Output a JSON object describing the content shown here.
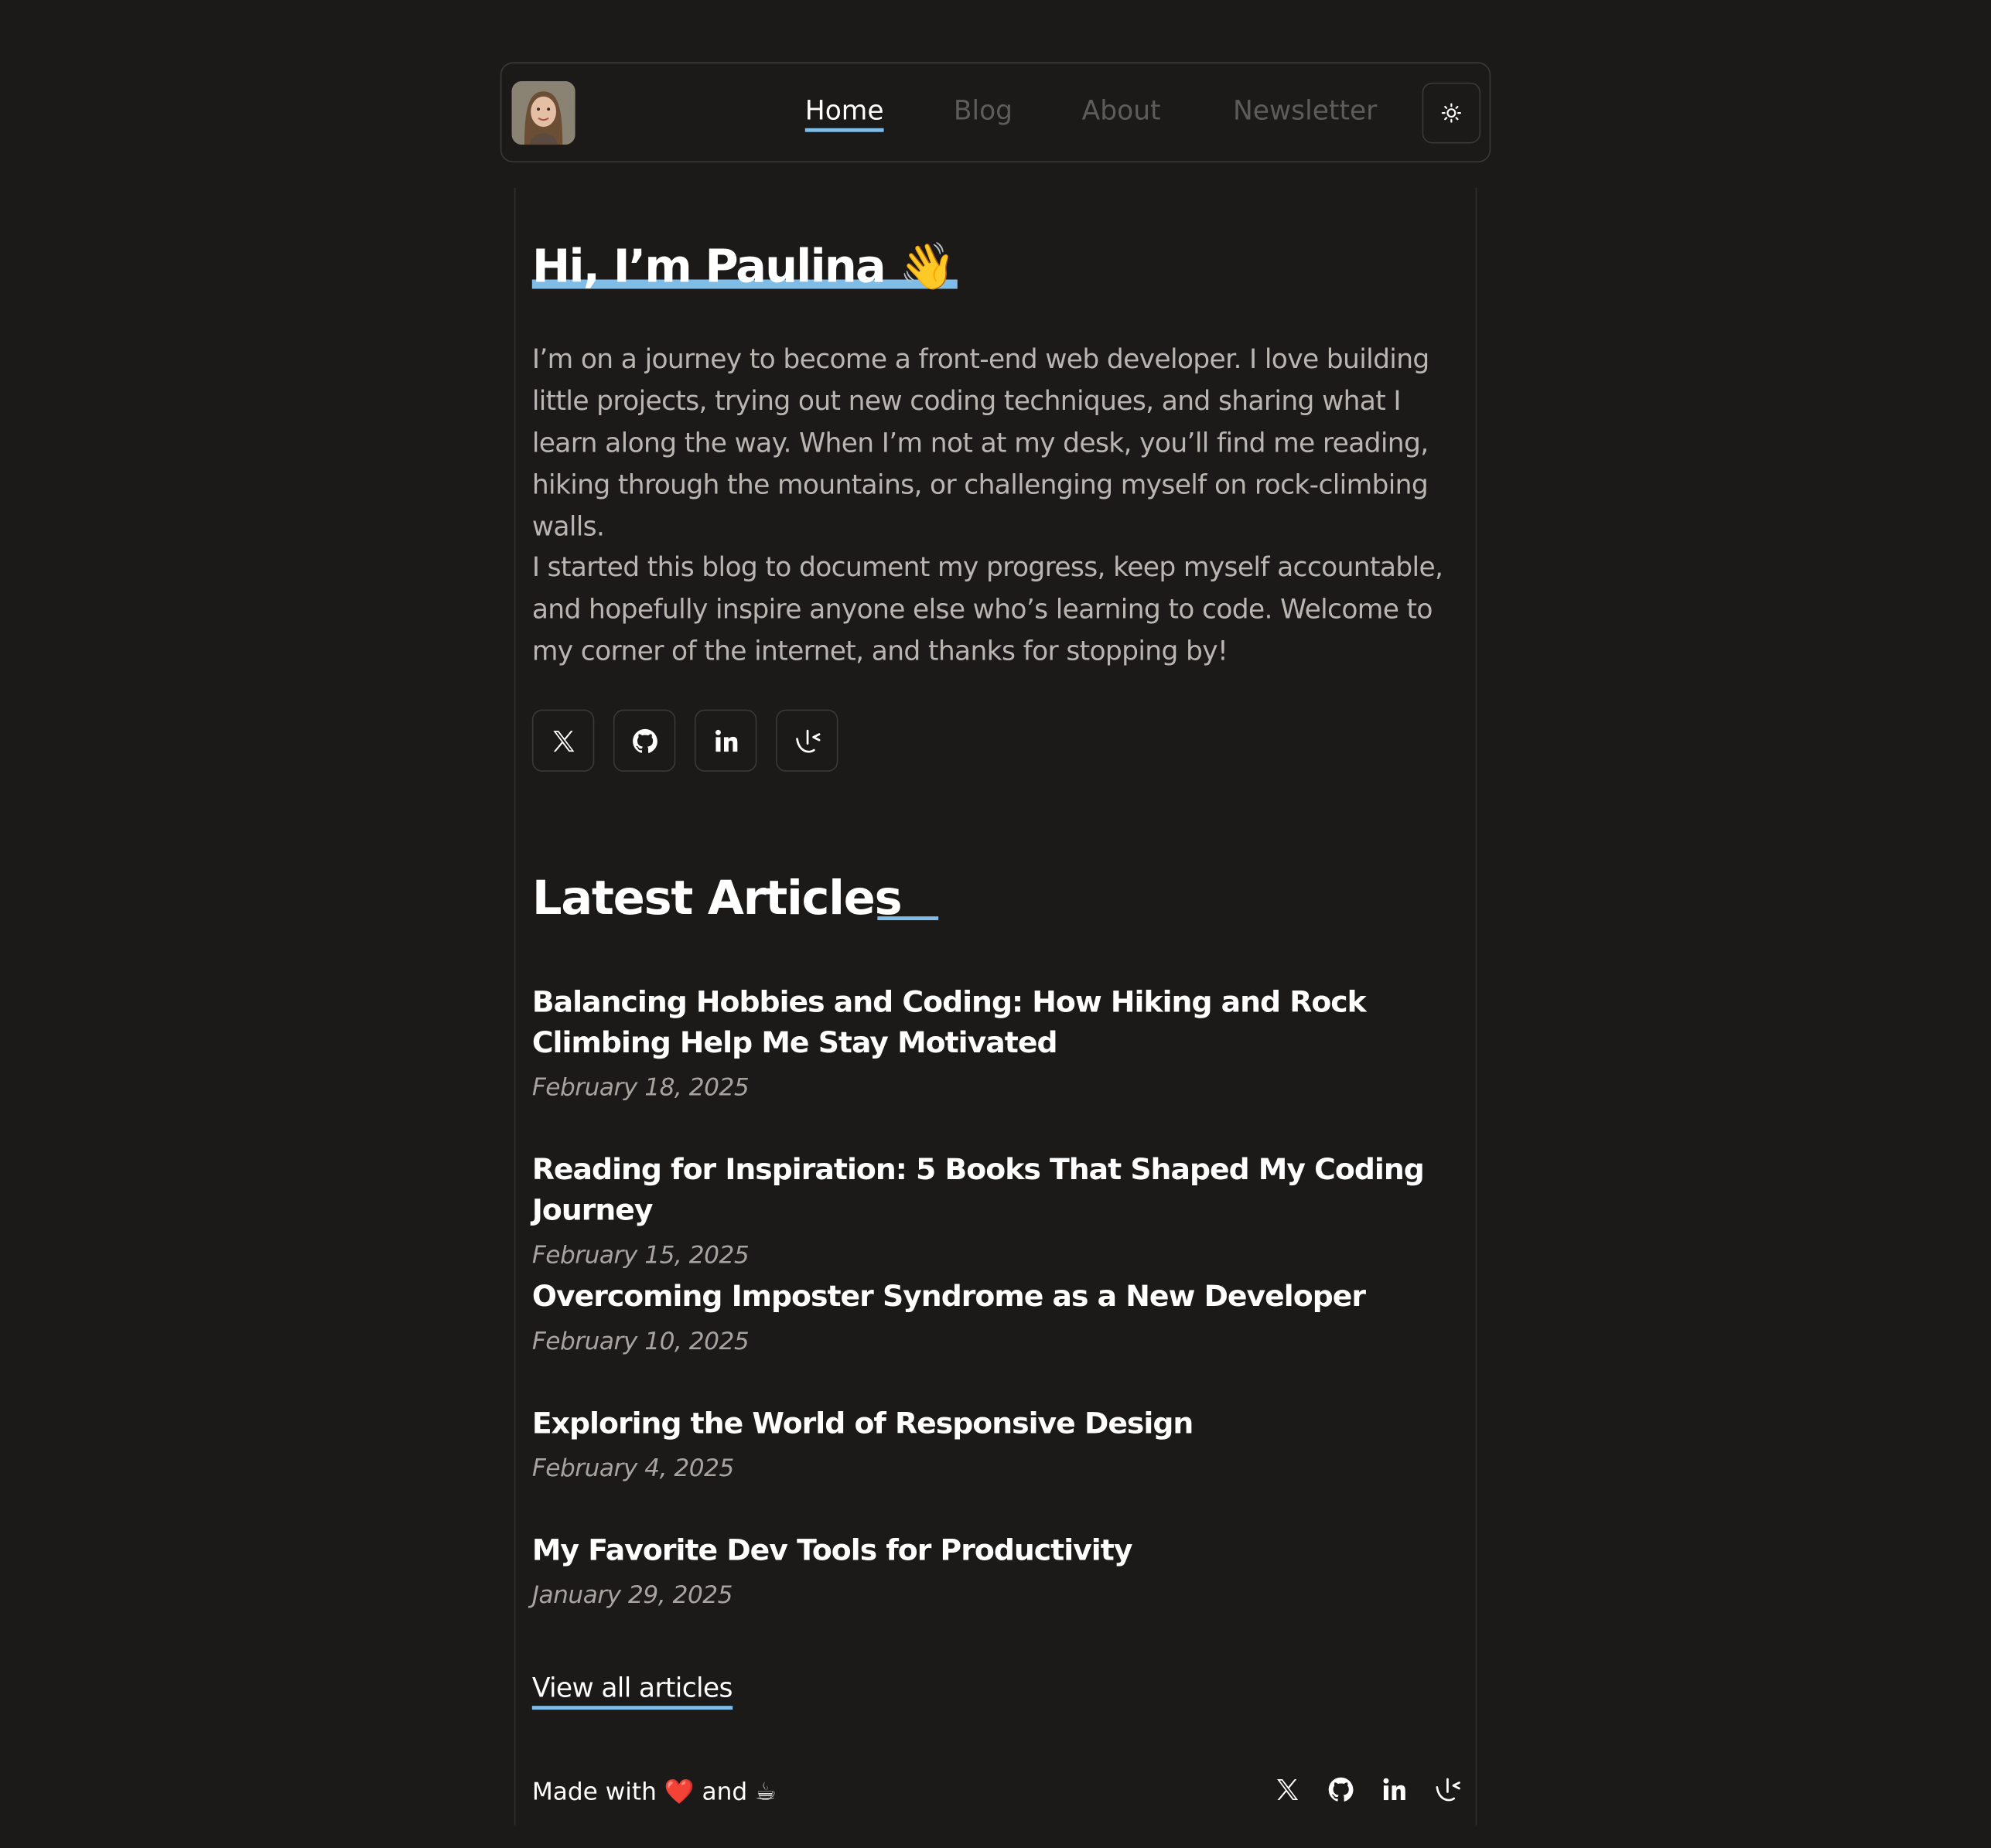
{
  "nav": {
    "links": [
      {
        "label": "Home",
        "active": true
      },
      {
        "label": "Blog",
        "active": false
      },
      {
        "label": "About",
        "active": false
      },
      {
        "label": "Newsletter",
        "active": false
      }
    ],
    "theme_icon": "sun-icon"
  },
  "hero": {
    "title": "Hi, I’m Paulina 👋",
    "paragraph1": "I’m on a journey to become a front-end web developer. I love building little projects, trying out new coding techniques, and sharing what I learn along the way. When I’m not at my desk, you’ll find me reading, hiking through the mountains, or challenging myself on rock-climbing walls.",
    "paragraph2": "I started this blog to document my progress, keep myself accountable, and hopefully inspire anyone else who’s learning to code. Welcome to my corner of the internet, and thanks for stopping by!",
    "social_icons": [
      "x-icon",
      "github-icon",
      "linkedin-icon",
      "frontend-mentor-icon"
    ]
  },
  "articles_section": {
    "title": "Latest Articles",
    "articles": [
      {
        "title": "Balancing Hobbies and Coding: How Hiking and Rock Climbing Help Me Stay Motivated",
        "date": "February 18, 2025"
      },
      {
        "title": "Reading for Inspiration: 5 Books That Shaped My Coding Journey",
        "date": "February 15, 2025"
      },
      {
        "title": "Overcoming Imposter Syndrome as a New Developer",
        "date": "February 10, 2025"
      },
      {
        "title": "Exploring the World of Responsive Design",
        "date": "February 4, 2025"
      },
      {
        "title": "My Favorite Dev Tools for Productivity",
        "date": "January 29, 2025"
      }
    ],
    "view_all": "View all articles"
  },
  "footer": {
    "made_with": "Made with",
    "heart": "❤️",
    "and": "and",
    "coffee": "☕",
    "icons": [
      "x-icon",
      "github-icon",
      "linkedin-icon",
      "frontend-mentor-icon"
    ]
  },
  "colors": {
    "background": "#1b1a19",
    "accent": "#7fbde8",
    "text": "#ffffff",
    "muted": "#b9b6b1"
  }
}
